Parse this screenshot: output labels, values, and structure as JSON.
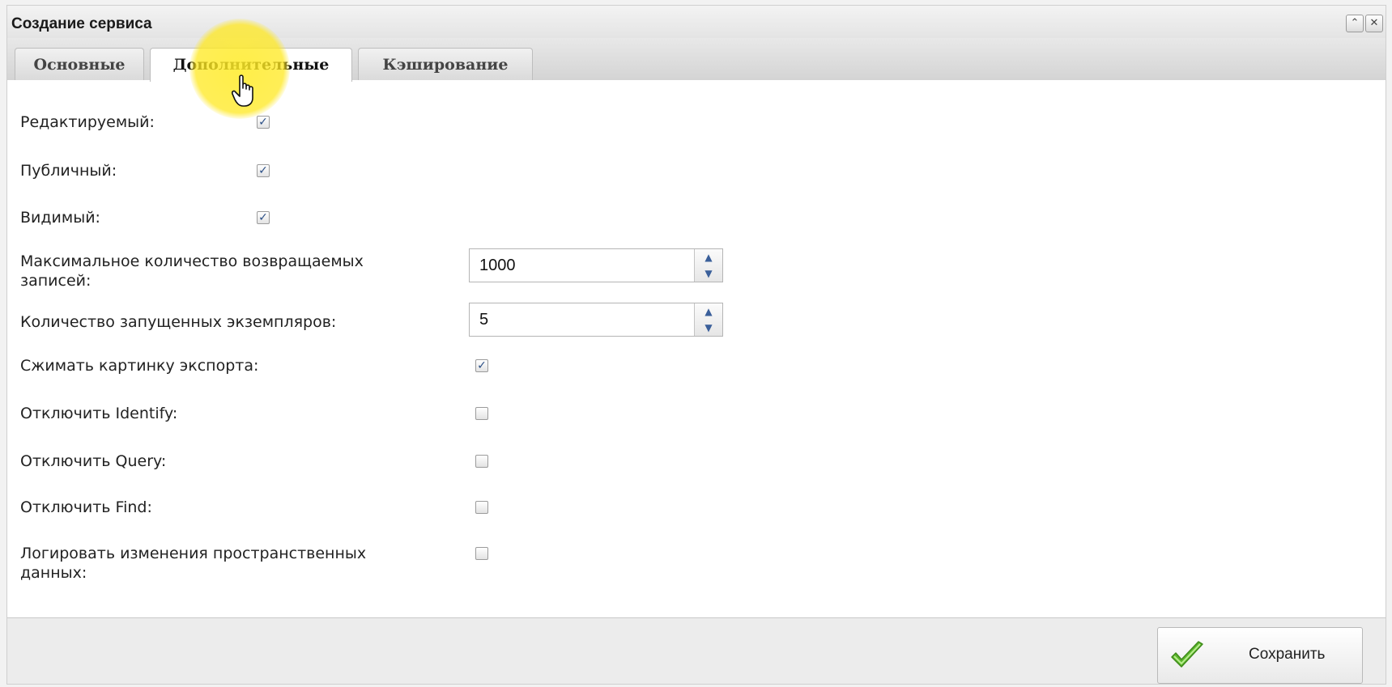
{
  "window": {
    "title": "Создание сервиса",
    "collapse_icon": "collapse-icon",
    "close_icon": "close-icon"
  },
  "tabs": [
    {
      "label": "Основные",
      "active": false
    },
    {
      "label": "Дополнительные",
      "active": true
    },
    {
      "label": "Кэширование",
      "active": false
    }
  ],
  "form": {
    "editable": {
      "label": "Редактируемый:",
      "checked": true
    },
    "public": {
      "label": "Публичный:",
      "checked": true
    },
    "visible": {
      "label": "Видимый:",
      "checked": true
    },
    "max_records": {
      "label_line1": "Максимальное количество возвращаемых",
      "label_line2": "записей:",
      "value": "1000"
    },
    "instances": {
      "label": "Количество запущенных экземпляров:",
      "value": "5"
    },
    "compress_export": {
      "label": "Сжимать картинку экспорта:",
      "checked": true
    },
    "disable_identify": {
      "label": "Отключить Identify:",
      "checked": false
    },
    "disable_query": {
      "label": "Отключить Query:",
      "checked": false
    },
    "disable_find": {
      "label": "Отключить Find:",
      "checked": false
    },
    "log_changes": {
      "label_line1": "Логировать изменения пространственных",
      "label_line2": "данных:",
      "checked": false
    }
  },
  "footer": {
    "save_label": "Сохранить",
    "save_icon": "checkmark-icon"
  },
  "colors": {
    "accent": "#2b4f86",
    "check_green": "#5cb82c",
    "highlight": "#ffe81e"
  },
  "glyphs": {
    "check": "✓",
    "spin_up": "▲",
    "spin_down": "▼",
    "collapse": "⌃",
    "close": "✕"
  }
}
